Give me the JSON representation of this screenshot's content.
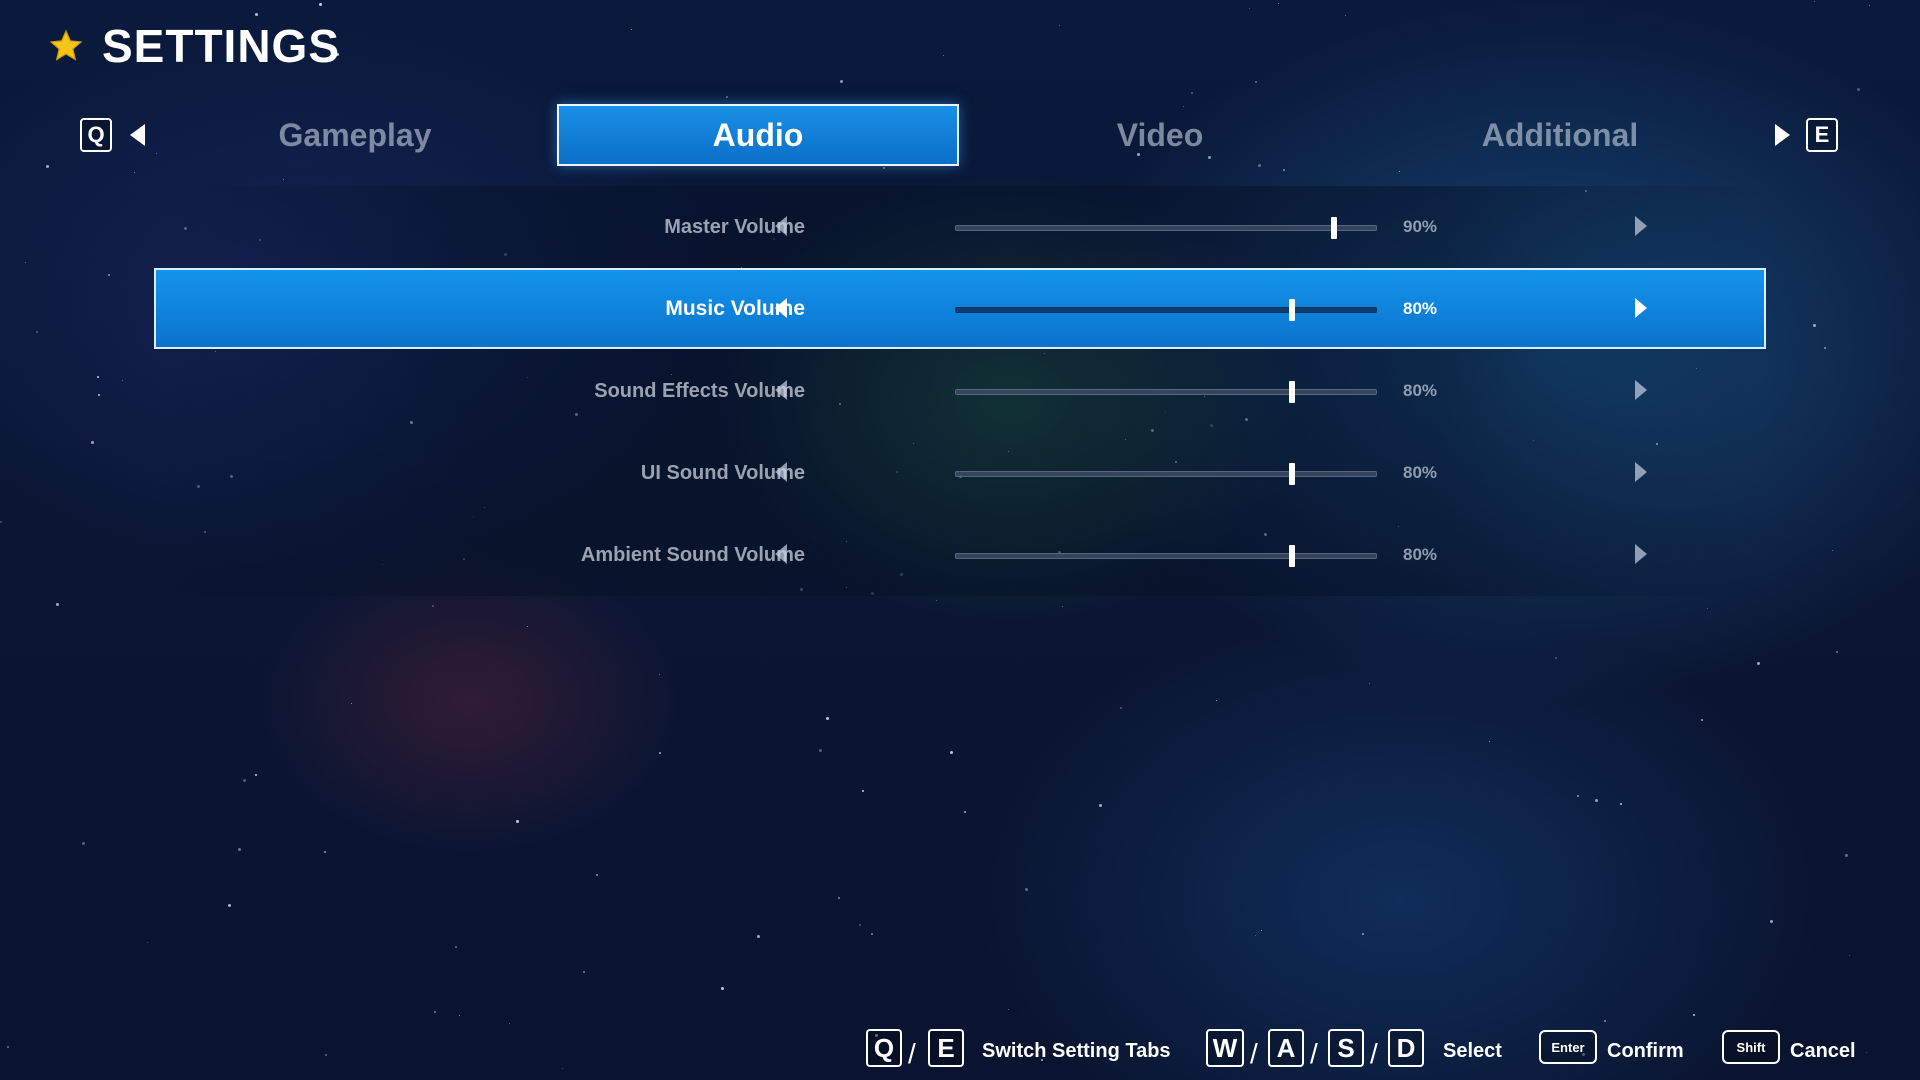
{
  "title": "SETTINGS",
  "tabs": {
    "prev_key": "Q",
    "next_key": "E",
    "items": [
      {
        "label": "Gameplay",
        "active": false
      },
      {
        "label": "Audio",
        "active": true
      },
      {
        "label": "Video",
        "active": false
      },
      {
        "label": "Additional",
        "active": false
      }
    ]
  },
  "settings": [
    {
      "label": "Master Volume",
      "value": "90%",
      "level": 0.9
    },
    {
      "label": "Music Volume",
      "value": "80%",
      "level": 0.8,
      "selected": true
    },
    {
      "label": "Sound Effects Volume",
      "value": "80%",
      "level": 0.8
    },
    {
      "label": "UI Sound Volume",
      "value": "80%",
      "level": 0.8
    },
    {
      "label": "Ambient Sound Volume",
      "value": "80%",
      "level": 0.8
    }
  ],
  "footer": {
    "switch_keys": [
      "Q",
      "E"
    ],
    "switch_label": "Switch Setting Tabs",
    "select_keys": [
      "W",
      "A",
      "S",
      "D"
    ],
    "select_label": "Select",
    "confirm_key": "Enter",
    "confirm_label": "Confirm",
    "cancel_key": "Shift",
    "cancel_label": "Cancel"
  },
  "colors": {
    "accent": "#0a7fd8",
    "highlight_border": "#dbeeff",
    "title_star": "#f5c518"
  },
  "icons": {
    "title": "star-icon",
    "tab_prev": "triangle-left-icon",
    "tab_next": "triangle-right-icon",
    "row_decrease": "triangle-left-icon",
    "row_increase": "triangle-right-icon"
  }
}
